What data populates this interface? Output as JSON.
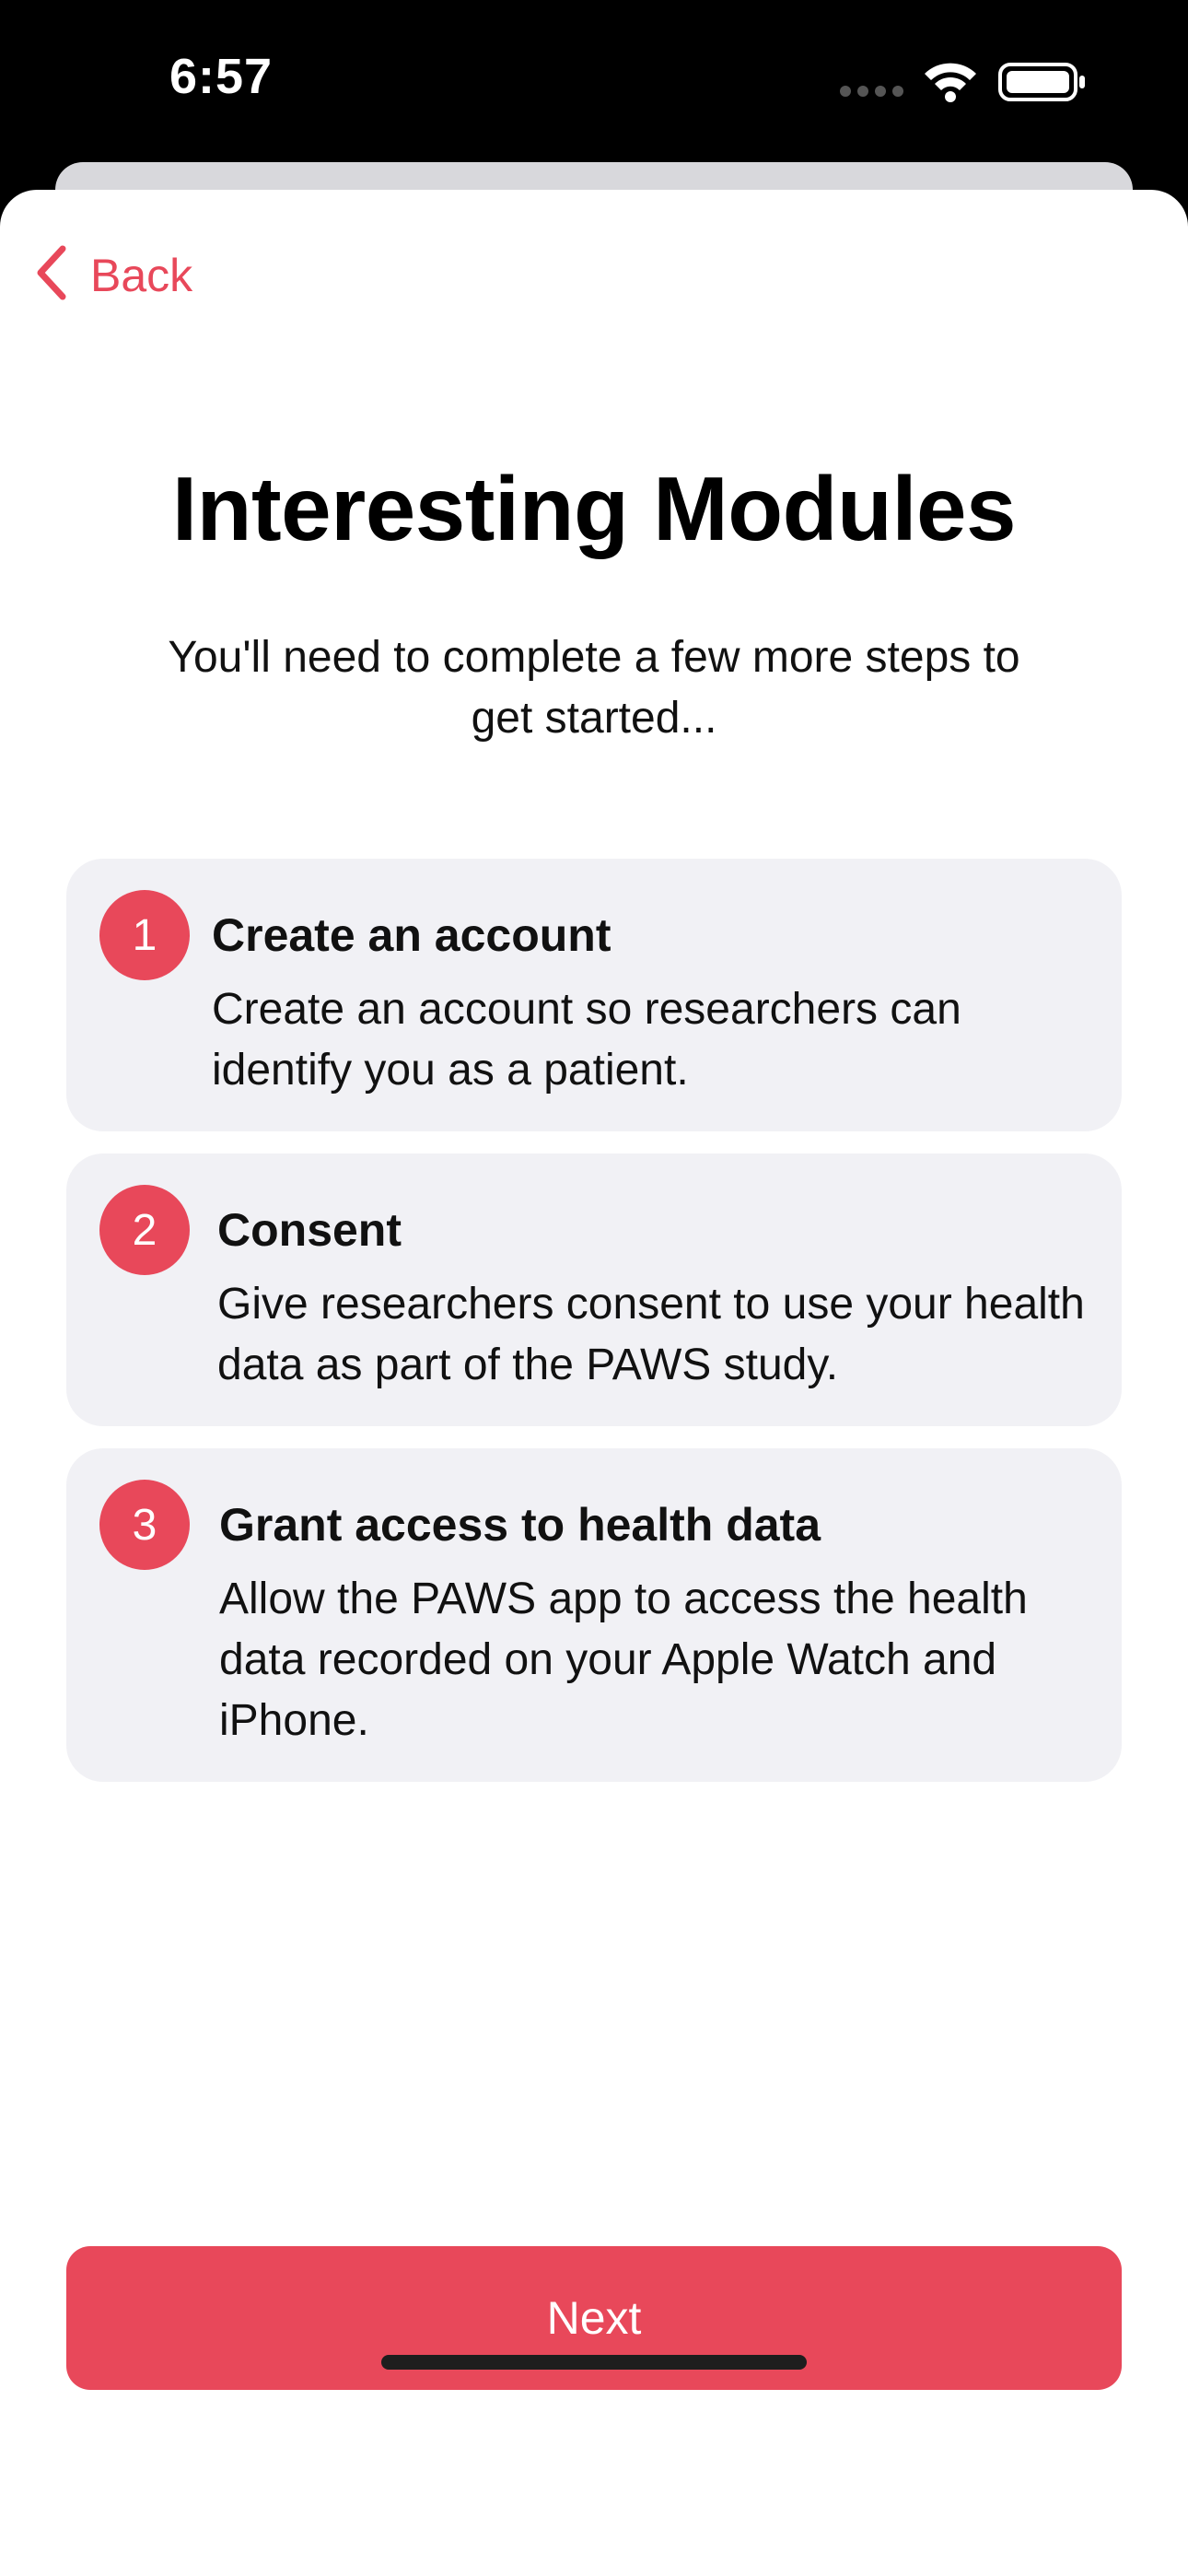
{
  "status_bar": {
    "time": "6:57",
    "icons": [
      "cellular-dots-icon",
      "wifi-icon",
      "battery-icon"
    ]
  },
  "nav": {
    "back_label": "Back"
  },
  "header": {
    "title": "Interesting Modules",
    "subtitle": "You'll need to complete a few more steps to get started..."
  },
  "steps": [
    {
      "number": "1",
      "title": "Create an account",
      "description": "Create an account so researchers can identify you as a patient."
    },
    {
      "number": "2",
      "title": "Consent",
      "description": "Give researchers consent to use your health data as part of the PAWS study."
    },
    {
      "number": "3",
      "title": "Grant access to health data",
      "description": "Allow the PAWS app to access the health data recorded on your Apple Watch and iPhone."
    }
  ],
  "footer": {
    "next_label": "Next"
  },
  "colors": {
    "accent": "#e8485a",
    "card_background": "#f1f1f5",
    "text": "#111111"
  }
}
